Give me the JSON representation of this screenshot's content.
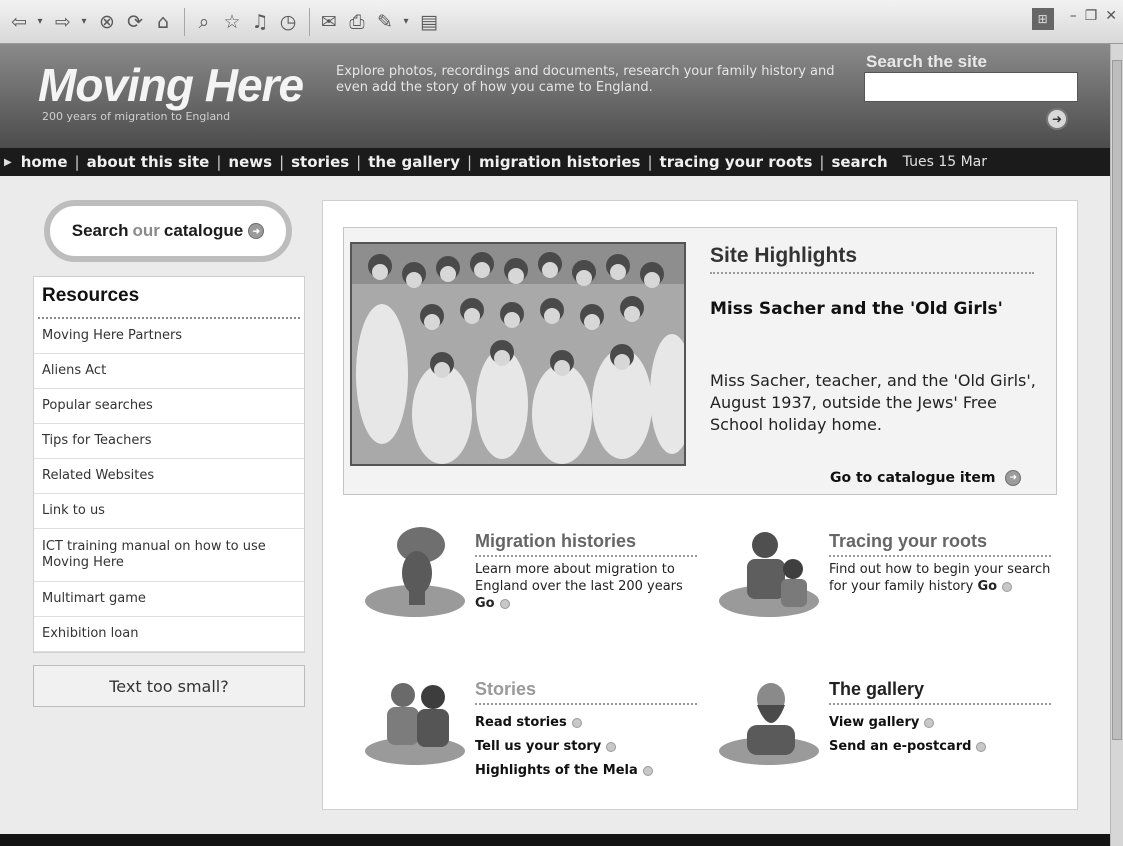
{
  "header": {
    "logo_title": "Moving Here",
    "logo_subtitle": "200 years of migration to England",
    "blurb": "Explore photos, recordings and documents, research your family history and even add the story of how you came to England.",
    "search_label": "Search the site"
  },
  "nav": {
    "items": [
      "home",
      "about this site",
      "news",
      "stories",
      "the gallery",
      "migration histories",
      "tracing your roots",
      "search"
    ],
    "date": "Tues 15 Mar"
  },
  "catalogue_search": {
    "part1": "Search",
    "part2": "our",
    "part3": "catalogue"
  },
  "resources": {
    "title": "Resources",
    "items": [
      "Moving Here Partners",
      "Aliens Act",
      "Popular searches",
      "Tips for Teachers",
      "Related Websites",
      "Link to us",
      "ICT training manual on how to use Moving Here",
      "Multimart game",
      "Exhibition loan"
    ]
  },
  "text_size_button": "Text too small?",
  "highlight": {
    "title": "Site Highlights",
    "headline": "Miss Sacher and the 'Old Girls'",
    "body": "Miss Sacher, teacher, and the 'Old Girls', August 1937, outside the Jews' Free School holiday home.",
    "link": "Go to catalogue item"
  },
  "features": {
    "migration": {
      "title": "Migration histories",
      "text": "Learn more about migration to England over the last 200 years",
      "go": "Go"
    },
    "roots": {
      "title": "Tracing your roots",
      "text": "Find out how to begin your search for your family history",
      "go": "Go"
    },
    "stories": {
      "title": "Stories",
      "links": [
        "Read stories",
        "Tell us your story",
        "Highlights of the Mela"
      ]
    },
    "gallery": {
      "title": "The gallery",
      "links": [
        "View gallery",
        "Send an e-postcard"
      ]
    }
  }
}
